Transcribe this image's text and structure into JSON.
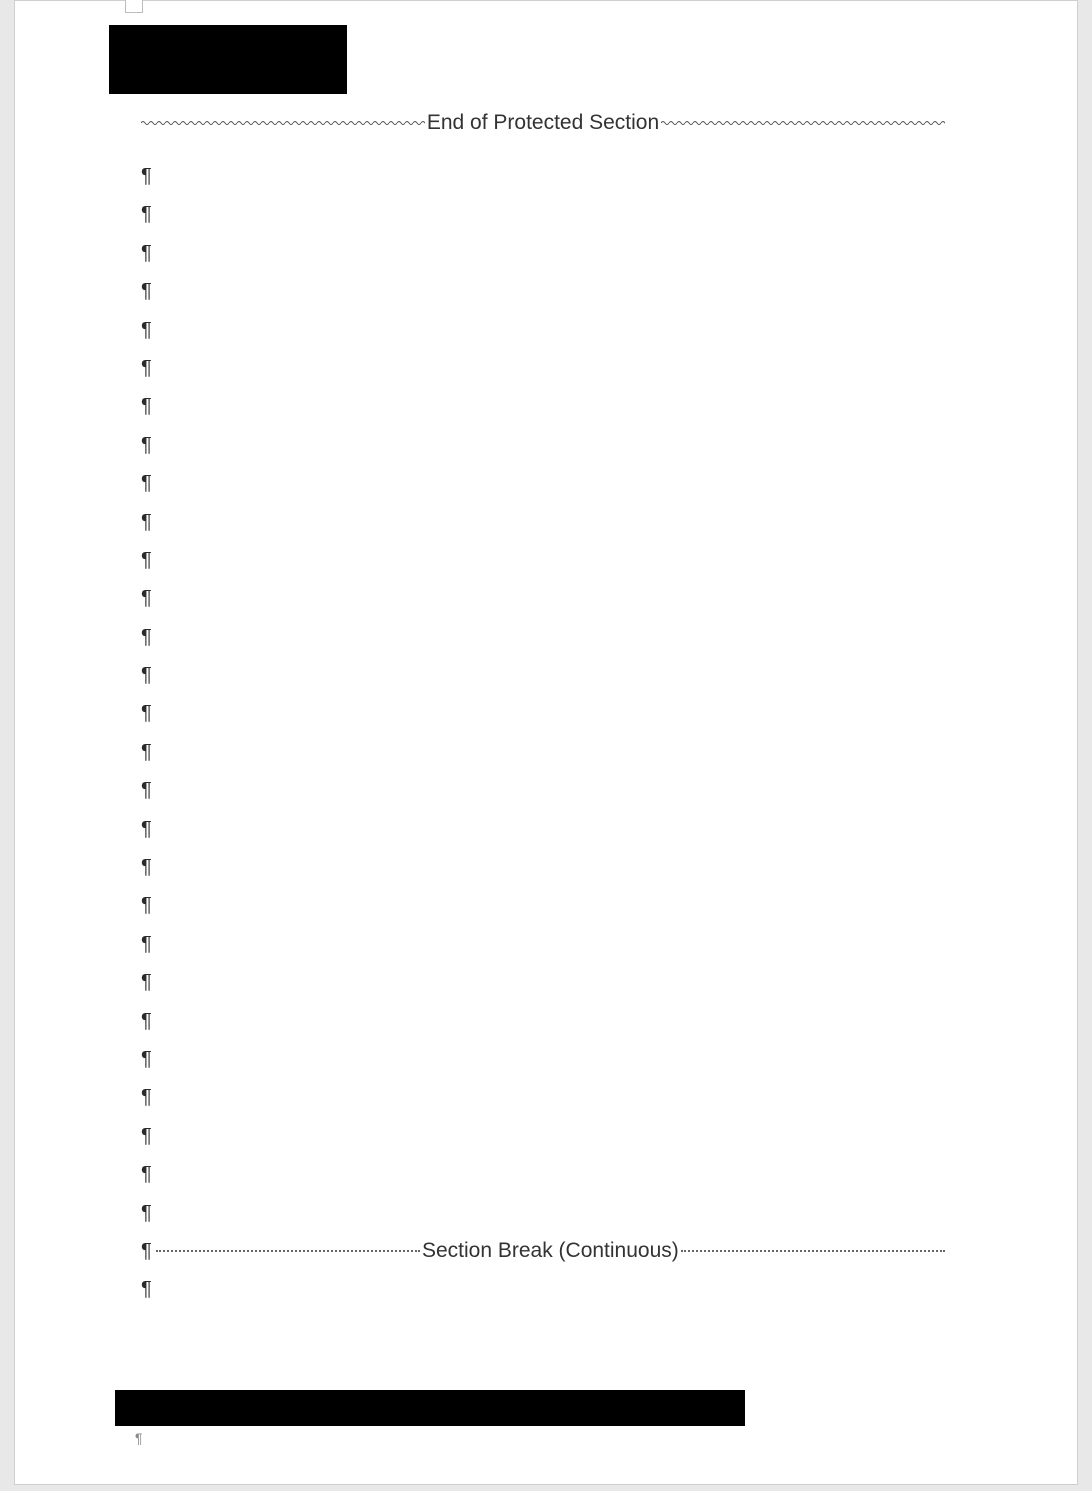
{
  "marks": {
    "pilcrow": "¶"
  },
  "dividers": {
    "protected_section": "End of Protected Section",
    "section_break": "Section Break (Continuous)"
  },
  "paragraphs": {
    "empty_count_before_break": 28,
    "empty_count_after_break": 1
  }
}
